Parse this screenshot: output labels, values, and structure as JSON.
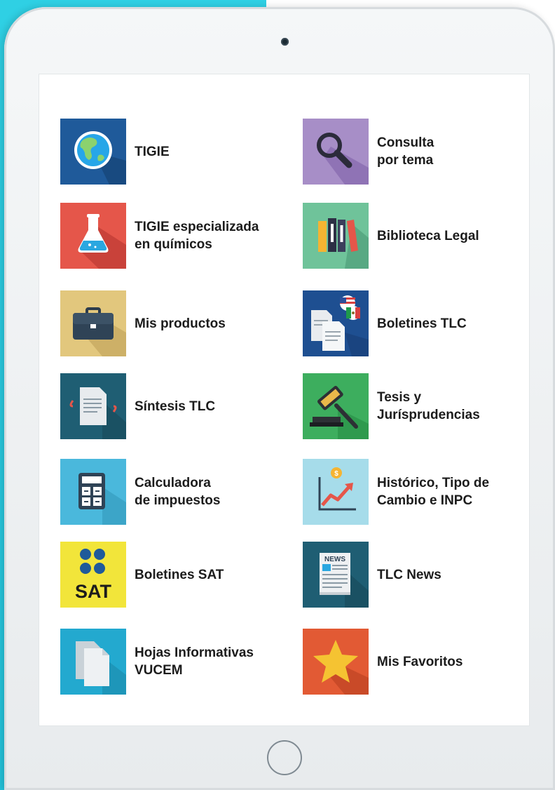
{
  "apps": [
    {
      "label": "TIGIE",
      "icon": "globe-icon",
      "color": "#1f5a9a"
    },
    {
      "label": "Consulta\npor tema",
      "icon": "magnifier-icon",
      "color": "#a78ec7"
    },
    {
      "label": "TIGIE especializada\nen químicos",
      "icon": "flask-icon",
      "color": "#e5564a"
    },
    {
      "label": "Biblioteca Legal",
      "icon": "books-icon",
      "color": "#6fc39a"
    },
    {
      "label": "Mis productos",
      "icon": "briefcase-icon",
      "color": "#e2c77d"
    },
    {
      "label": "Boletines TLC",
      "icon": "documents-flags-icon",
      "color": "#1e4f91"
    },
    {
      "label": "Síntesis TLC",
      "icon": "document-icon",
      "color": "#1f5e73"
    },
    {
      "label": "Tesis y\nJurísprudencias",
      "icon": "gavel-icon",
      "color": "#3dae5e"
    },
    {
      "label": "Calculadora\nde impuestos",
      "icon": "calculator-icon",
      "color": "#4ab8dc"
    },
    {
      "label": "Histórico, Tipo de\nCambio e INPC",
      "icon": "chart-coin-icon",
      "color": "#a6dcea"
    },
    {
      "label": "Boletines SAT",
      "icon": "sat-logo-icon",
      "color": "#f2e53a",
      "logo_text": "SAT"
    },
    {
      "label": "TLC News",
      "icon": "newspaper-icon",
      "color": "#1f5e73",
      "logo_text": "NEWS"
    },
    {
      "label": "Hojas Informativas\nVUCEM",
      "icon": "pages-icon",
      "color": "#23a9cf"
    },
    {
      "label": "Mis Favoritos",
      "icon": "star-icon",
      "color": "#e25a34"
    }
  ]
}
